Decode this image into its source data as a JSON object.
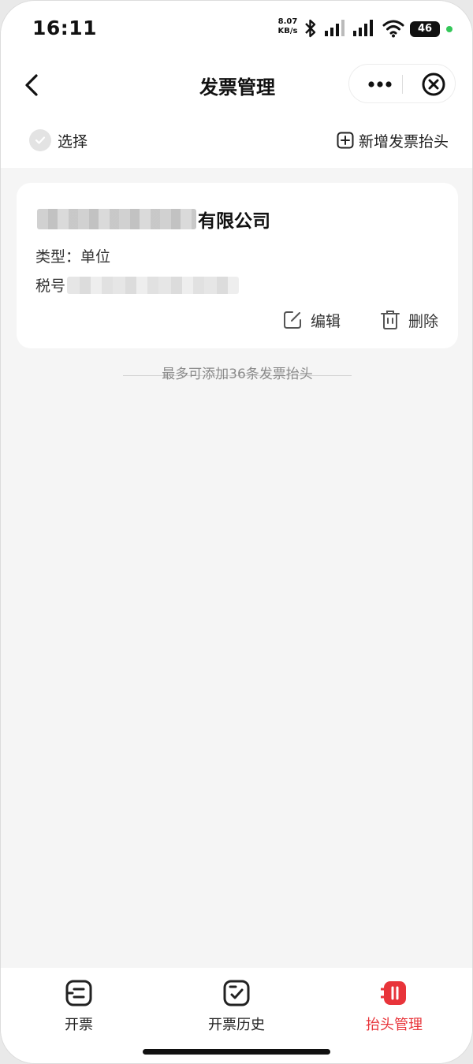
{
  "status_bar": {
    "time": "16:11",
    "net_speed_value": "8.07",
    "net_speed_unit": "KB/s",
    "battery": "46",
    "icons": [
      "bluetooth-icon",
      "signal-icon",
      "signal-icon",
      "wifi-icon",
      "battery-icon"
    ]
  },
  "nav": {
    "title": "发票管理",
    "icons": [
      "back-arrow-icon",
      "more-icon",
      "close-circle-icon"
    ]
  },
  "toolbar": {
    "select_label": "选择",
    "add_label": "新增发票抬头"
  },
  "invoice_card": {
    "company_name_visible": "有限公司",
    "type_label": "类型：",
    "type_value": "单位",
    "tax_label": "税号",
    "edit_label": "编辑",
    "delete_label": "删除"
  },
  "limit_note": "最多可添加36条发票抬头",
  "tabs": [
    {
      "label": "开票",
      "icon": "invoice-icon",
      "active": false
    },
    {
      "label": "开票历史",
      "icon": "invoice-history-icon",
      "active": false
    },
    {
      "label": "抬头管理",
      "icon": "title-manage-icon",
      "active": true
    }
  ],
  "colors": {
    "accent": "#e8343a",
    "background": "#f5f5f5",
    "card": "#ffffff"
  }
}
